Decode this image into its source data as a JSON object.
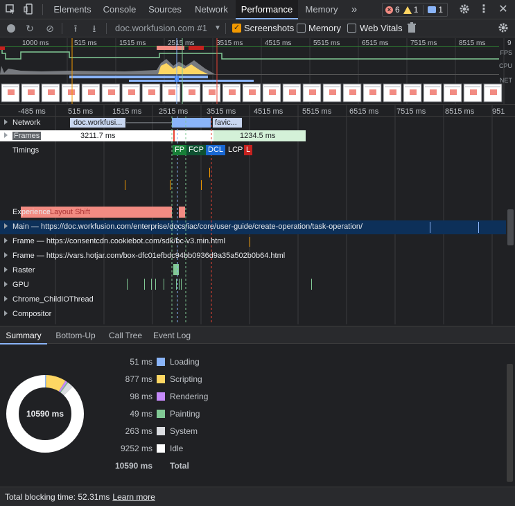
{
  "devtools": {
    "tabs": [
      "Elements",
      "Console",
      "Sources",
      "Network",
      "Performance",
      "Memory"
    ],
    "active_tab": "Performance",
    "more_tabs": "»",
    "errors": "6",
    "warnings": "1",
    "messages": "1"
  },
  "toolbar": {
    "profile": "doc.workfusion.com #1",
    "screenshots_label": "Screenshots",
    "memory_label": "Memory",
    "web_vitals_label": "Web Vitals",
    "screenshots_checked": true,
    "memory_checked": false,
    "web_vitals_checked": false
  },
  "overview": {
    "ticks": [
      "1000 ms",
      "515 ms",
      "1515 ms",
      "2515 ms",
      "3515 ms",
      "4515 ms",
      "5515 ms",
      "6515 ms",
      "7515 ms",
      "8515 ms",
      "9"
    ],
    "lanes": [
      "FPS",
      "CPU",
      "NET"
    ]
  },
  "timeline": {
    "ticks": [
      "-485 ms",
      "515 ms",
      "1515 ms",
      "2515 ms",
      "3515 ms",
      "4515 ms",
      "5515 ms",
      "6515 ms",
      "7515 ms",
      "8515 ms",
      "951"
    ],
    "tracks": {
      "network": "Network",
      "network_req1": "doc.workfusi...",
      "network_req2": "favic...",
      "frames": "Frames",
      "frame1": "3211.7 ms",
      "frame2": "1234.5 ms",
      "timings": "Timings",
      "experience": "Experience",
      "layout_shift": "Layout Shift",
      "main": "Main — https://doc.workfusion.com/enterprise/docs/iac/core/user-guide/create-operation/task-operation/",
      "frame_cookiebot": "Frame — https://consentcdn.cookiebot.com/sdk/bc-v3.min.html",
      "frame_hotjar": "Frame — https://vars.hotjar.com/box-dfc01efbdc94bb0936d9a35a502b0b64.html",
      "raster": "Raster",
      "gpu": "GPU",
      "child_io": "Chrome_ChildIOThread",
      "compositor": "Compositor"
    },
    "markers": [
      "FP",
      "FCP",
      "DCL",
      "LCP",
      "L"
    ]
  },
  "bottom_tabs": [
    "Summary",
    "Bottom-Up",
    "Call Tree",
    "Event Log"
  ],
  "summary": {
    "total_center": "10590 ms",
    "rows": [
      {
        "value": "51 ms",
        "label": "Loading",
        "color": "#8ab4f8"
      },
      {
        "value": "877 ms",
        "label": "Scripting",
        "color": "#fdd663"
      },
      {
        "value": "98 ms",
        "label": "Rendering",
        "color": "#c58af9"
      },
      {
        "value": "49 ms",
        "label": "Painting",
        "color": "#81c995"
      },
      {
        "value": "263 ms",
        "label": "System",
        "color": "#dadce0"
      },
      {
        "value": "9252 ms",
        "label": "Idle",
        "color": "#ffffff"
      }
    ],
    "total_value": "10590 ms",
    "total_label": "Total"
  },
  "footer": {
    "tbt_text": "Total blocking time: 52.31ms",
    "learn_more": "Learn more"
  }
}
